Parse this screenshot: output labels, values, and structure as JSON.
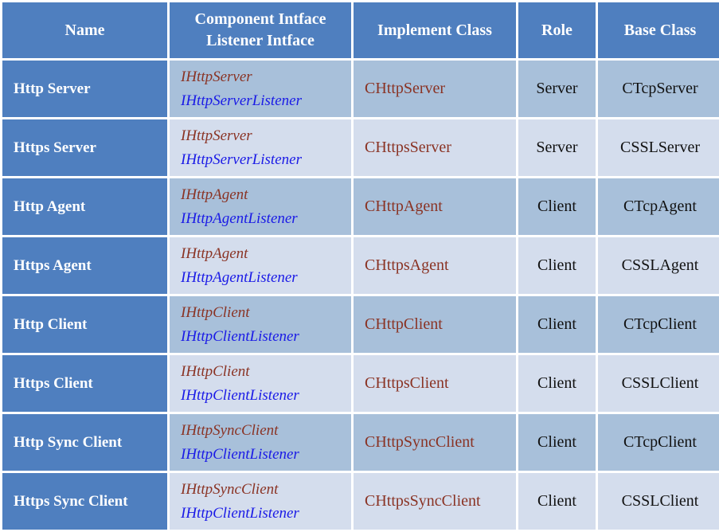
{
  "table": {
    "columns": [
      {
        "key": "name",
        "label": "Name",
        "lines": [
          "Name"
        ]
      },
      {
        "key": "iface",
        "label": "Component Intface Listener Intface",
        "lines": [
          "Component Intface",
          "Listener Intface"
        ]
      },
      {
        "key": "impl",
        "label": "Implement Class",
        "lines": [
          "Implement Class"
        ]
      },
      {
        "key": "role",
        "label": "Role",
        "lines": [
          "Role"
        ]
      },
      {
        "key": "base",
        "label": "Base Class",
        "lines": [
          "Base Class"
        ]
      }
    ],
    "rows": [
      {
        "name": "Http Server",
        "component_interface": "IHttpServer",
        "listener_interface": "IHttpServerListener",
        "implement_class": "CHttpServer",
        "role": "Server",
        "base_class": "CTcpServer",
        "shade": "dark"
      },
      {
        "name": "Https Server",
        "component_interface": "IHttpServer",
        "listener_interface": "IHttpServerListener",
        "implement_class": "CHttpsServer",
        "role": "Server",
        "base_class": "CSSLServer",
        "shade": "light"
      },
      {
        "name": "Http Agent",
        "component_interface": "IHttpAgent",
        "listener_interface": "IHttpAgentListener",
        "implement_class": "CHttpAgent",
        "role": "Client",
        "base_class": "CTcpAgent",
        "shade": "dark"
      },
      {
        "name": "Https Agent",
        "component_interface": "IHttpAgent",
        "listener_interface": "IHttpAgentListener",
        "implement_class": "CHttpsAgent",
        "role": "Client",
        "base_class": "CSSLAgent",
        "shade": "light"
      },
      {
        "name": "Http Client",
        "component_interface": "IHttpClient",
        "listener_interface": "IHttpClientListener",
        "implement_class": "CHttpClient",
        "role": "Client",
        "base_class": "CTcpClient",
        "shade": "dark"
      },
      {
        "name": "Https Client",
        "component_interface": "IHttpClient",
        "listener_interface": "IHttpClientListener",
        "implement_class": "CHttpsClient",
        "role": "Client",
        "base_class": "CSSLClient",
        "shade": "light"
      },
      {
        "name": "Http Sync Client",
        "component_interface": "IHttpSyncClient",
        "listener_interface": "IHttpClientListener",
        "implement_class": "CHttpSyncClient",
        "role": "Client",
        "base_class": "CTcpClient",
        "shade": "dark"
      },
      {
        "name": "Https Sync Client",
        "component_interface": "IHttpSyncClient",
        "listener_interface": "IHttpClientListener",
        "implement_class": "CHttpsSyncClient",
        "role": "Client",
        "base_class": "CSSLClient",
        "shade": "light"
      }
    ]
  },
  "colors": {
    "header_background": "#4f7fbf",
    "header_text": "#ffffff",
    "row_dark": "#a8c0da",
    "row_light": "#d4dded",
    "component_interface_text": "#8a3324",
    "listener_interface_text": "#1a1ae6",
    "implement_class_text": "#8a3324",
    "plain_text": "#111111",
    "page_background": "#ffffff"
  }
}
